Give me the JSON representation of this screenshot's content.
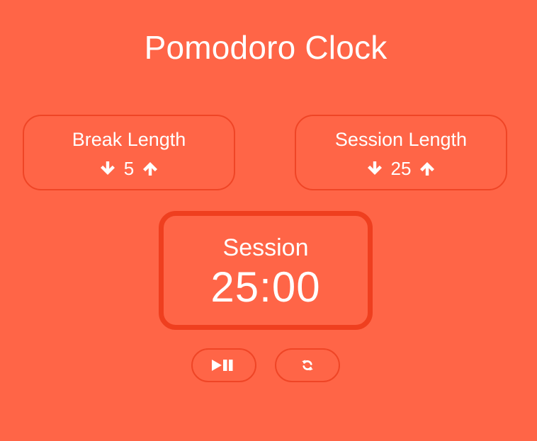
{
  "app": {
    "title": "Pomodoro Clock"
  },
  "break": {
    "label": "Break Length",
    "value": "5",
    "decrement_icon": "arrow-down-icon",
    "increment_icon": "arrow-up-icon"
  },
  "session": {
    "label": "Session Length",
    "value": "25",
    "decrement_icon": "arrow-down-icon",
    "increment_icon": "arrow-up-icon"
  },
  "timer": {
    "label": "Session",
    "time": "25:00"
  },
  "buttons": {
    "play_pause_icon": "play-pause-icon",
    "reset_icon": "refresh-icon"
  },
  "colors": {
    "background": "#ff6547",
    "border": "#ef4526",
    "timer_border": "#ef3f1f",
    "text": "#ffffff"
  }
}
